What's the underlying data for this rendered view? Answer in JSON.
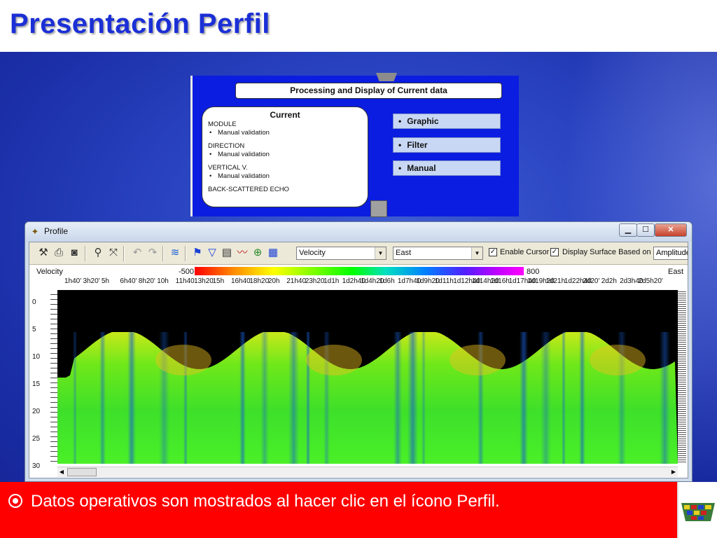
{
  "slide": {
    "title": "Presentación Perfil",
    "bullet": "Datos operativos son mostrados al hacer clic en el ícono Perfil."
  },
  "panel": {
    "header": "Processing and Display of Current data",
    "current_title": "Current",
    "groups": [
      {
        "name": "MODULE",
        "item": "Manual validation"
      },
      {
        "name": "DIRECTION",
        "item": "Manual validation"
      },
      {
        "name": "VERTICAL V.",
        "item": "Manual validation"
      }
    ],
    "last_group": "BACK-SCATTERED ECHO",
    "options": [
      "Graphic",
      "Filter",
      "Manual"
    ]
  },
  "window": {
    "title": "Profile",
    "minimize": "▁",
    "maximize": "☐",
    "close": "✕",
    "toolbar": {
      "variable_select": "Velocity",
      "direction_select": "East",
      "enable_cursor_label": "Enable Cursor",
      "enable_cursor_checked": true,
      "display_surface_label": "Display Surface Based on",
      "display_surface_checked": true,
      "amplitude_value": "Amplitude"
    },
    "colorbar": {
      "left_label": "Velocity",
      "min": "-500",
      "max": "800",
      "right_label": "East"
    },
    "time_labels": [
      "1h40'",
      "3h20'",
      "5h",
      "6h40'",
      "8h20'",
      "10h",
      "11h40",
      "13h20",
      "15h",
      "16h40",
      "18h20",
      "20h",
      "21h40",
      "23h20",
      "1d1h",
      "1d2h40",
      "1d4h20",
      "1d6h",
      "1d7h40",
      "1d9h20",
      "1d11h",
      "1d12h40",
      "1d14h20",
      "1d16h",
      "1d17h40",
      "1d19h20",
      "1d21h",
      "1d22h40",
      "2d20'",
      "2d2h",
      "2d3h40",
      "2d5h20'"
    ],
    "depth_labels": [
      "0",
      "5",
      "10",
      "15",
      "20",
      "25",
      "30"
    ]
  },
  "icons": [
    "tools-icon",
    "print-icon",
    "camera-icon",
    "zoom-icon",
    "fit-icon",
    "undo-icon",
    "redo-icon",
    "wave-icon",
    "pump-icon",
    "filter-icon",
    "document-icon",
    "chart-icon",
    "compass-icon",
    "grid-icon"
  ]
}
